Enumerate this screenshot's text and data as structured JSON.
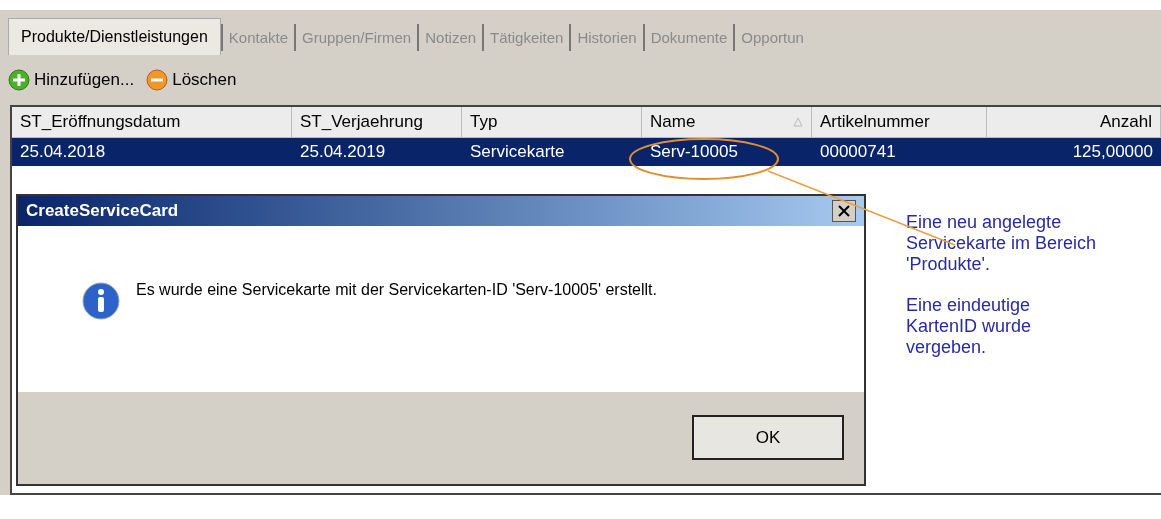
{
  "tabs": [
    {
      "label": "Produkte/Dienstleistungen",
      "selected": true
    },
    {
      "label": "Kontakte",
      "selected": false
    },
    {
      "label": "Gruppen/Firmen",
      "selected": false
    },
    {
      "label": "Notizen",
      "selected": false
    },
    {
      "label": "Tätigkeiten",
      "selected": false
    },
    {
      "label": "Historien",
      "selected": false
    },
    {
      "label": "Dokumente",
      "selected": false
    },
    {
      "label": "Opportun",
      "selected": false
    }
  ],
  "toolbar": [
    {
      "kind": "add",
      "label": "Hinzufügen..."
    },
    {
      "kind": "delete",
      "label": "Löschen"
    }
  ],
  "table": {
    "columns": [
      {
        "label": "ST_Eröffnungsdatum",
        "sorted": false
      },
      {
        "label": "ST_Verjaehrung",
        "sorted": false
      },
      {
        "label": "Typ",
        "sorted": false
      },
      {
        "label": "Name",
        "sorted": true
      },
      {
        "label": "Artikelnummer",
        "sorted": false
      },
      {
        "label": "Anzahl",
        "sorted": false
      }
    ],
    "rows": [
      {
        "selected": true,
        "cells": [
          "25.04.2018",
          "25.04.2019",
          "Servicekarte",
          "Serv-10005",
          "00000741",
          "125,00000"
        ]
      }
    ]
  },
  "dialog": {
    "title": "CreateServiceCard",
    "message": "Es wurde eine Servicekarte mit der Servicekarten-ID 'Serv-10005' erstellt.",
    "button": "OK"
  },
  "annotation": {
    "paragraphs": [
      "Eine neu angelegte Servicekarte im Bereich 'Produkte'.",
      "Eine eindeutige KartenID wurde vergeben."
    ]
  }
}
